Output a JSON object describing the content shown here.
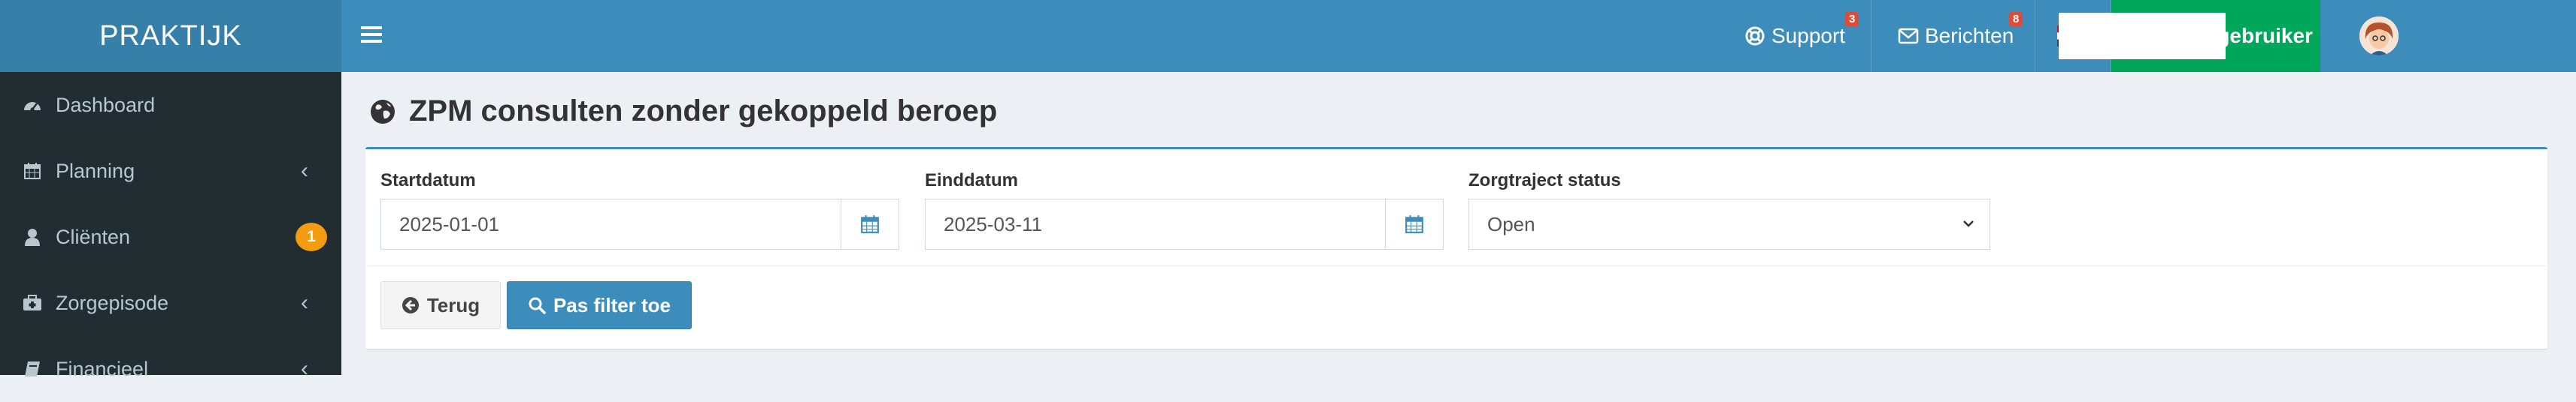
{
  "brand": {
    "name": "PRAKTIJK"
  },
  "topbar": {
    "support_label": "Support",
    "support_badge": "3",
    "messages_label": "Berichten",
    "messages_badge": "8",
    "language_flag": "netherlands-flag-icon",
    "switch_user_label": "Wissel gebruiker",
    "username": ""
  },
  "sidebar": {
    "items": [
      {
        "label": "Dashboard",
        "icon": "dashboard-icon",
        "chevron": false
      },
      {
        "label": "Planning",
        "icon": "calendar-icon",
        "chevron": true
      },
      {
        "label": "Cliënten",
        "icon": "user-icon",
        "badge": "1"
      },
      {
        "label": "Zorgepisode",
        "icon": "medkit-icon",
        "chevron": true
      },
      {
        "label": "Financieel",
        "icon": "book-icon",
        "chevron": true
      }
    ]
  },
  "page": {
    "title": "ZPM consulten zonder gekoppeld beroep"
  },
  "filters": {
    "start_label": "Startdatum",
    "start_value": "2025-01-01",
    "end_label": "Einddatum",
    "end_value": "2025-03-11",
    "status_label": "Zorgtraject status",
    "status_value": "Open"
  },
  "actions": {
    "back_label": "Terug",
    "apply_label": "Pas filter toe"
  },
  "colors": {
    "header": "#3c8dbc",
    "brand_bg": "#367fa9",
    "sidebar_bg": "#222d32",
    "switch_user_bg": "#00a65a",
    "badge_red": "#dd4b39",
    "badge_orange": "#f39c12"
  }
}
